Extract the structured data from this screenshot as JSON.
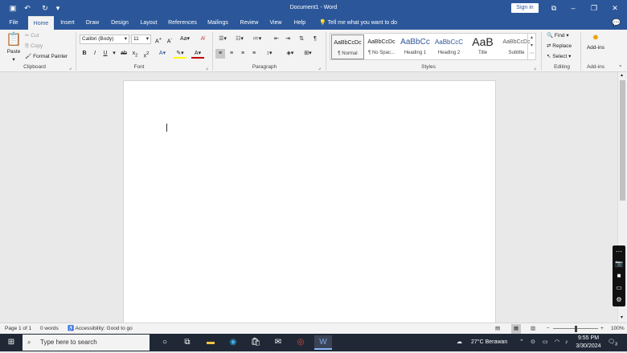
{
  "window": {
    "title": "Document1 - Word",
    "sign_in_label": "Sign in"
  },
  "tabs": [
    "File",
    "Home",
    "Insert",
    "Draw",
    "Design",
    "Layout",
    "References",
    "Mailings",
    "Review",
    "View",
    "Help"
  ],
  "active_tab": "Home",
  "tell_me": "Tell me what you want to do",
  "clipboard": {
    "paste": "Paste",
    "cut": "Cut",
    "copy": "Copy",
    "format_painter": "Format Painter",
    "label": "Clipboard"
  },
  "font": {
    "family": "Calibri (Body)",
    "size": "11",
    "label": "Font"
  },
  "paragraph": {
    "label": "Paragraph"
  },
  "styles": {
    "items": [
      {
        "preview": "AaBbCcDc",
        "name": "¶ Normal"
      },
      {
        "preview": "AaBbCcDc",
        "name": "¶ No Spac..."
      },
      {
        "preview": "AaBbCc",
        "name": "Heading 1"
      },
      {
        "preview": "AaBbCcC",
        "name": "Heading 2"
      },
      {
        "preview": "AaB",
        "name": "Title"
      },
      {
        "preview": "AaBbCcDc",
        "name": "Subtitle"
      }
    ],
    "label": "Styles"
  },
  "editing": {
    "find": "Find",
    "replace": "Replace",
    "select": "Select",
    "label": "Editing"
  },
  "addins": {
    "button": "Add-ins",
    "label": "Add-ins"
  },
  "status": {
    "page": "Page 1 of 1",
    "words": "0 words",
    "accessibility": "Accessibility: Good to go",
    "zoom": "100%",
    "zoom_level": 1.0
  },
  "taskbar": {
    "search_placeholder": "Type here to search",
    "weather": "27°C  Berawan",
    "time": "9:55 PM",
    "date": "3/30/2024",
    "notification_count": "3"
  },
  "colors": {
    "word_blue": "#2b579a",
    "taskbar": "#202836",
    "font_color_bar": "#c00000",
    "highlight_bar": "#ffff00"
  }
}
